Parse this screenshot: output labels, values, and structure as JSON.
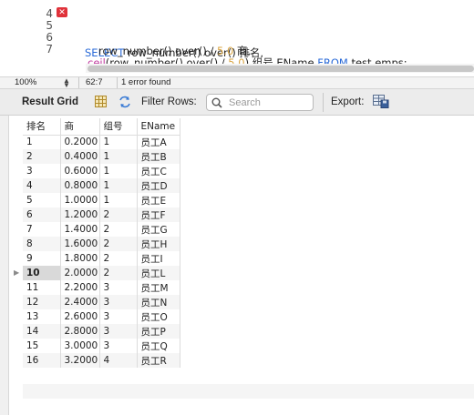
{
  "editor": {
    "lines": [
      {
        "number": "4",
        "has_error": false
      },
      {
        "number": "5",
        "has_error": true
      },
      {
        "number": "6",
        "has_error": false
      },
      {
        "number": "7",
        "has_error": false
      }
    ],
    "error_marker": "✕",
    "sql": {
      "line5_kw_select": "SELECT",
      "line5_rest": " row_number() over() 排名,",
      "line6_rest": "row_number() over() / ",
      "line6_num": "5.0",
      "line6_tail": " 商,",
      "line7_fn": "ceil",
      "line7_mid": "(row_number() over() / ",
      "line7_num": "5.0",
      "line7_tail": ") 组号,EName ",
      "line7_kw_from": "FROM",
      "line7_end": " test.emps;"
    }
  },
  "status": {
    "zoom": "100%",
    "cursor": "62:7",
    "message": "1 error found"
  },
  "toolbar": {
    "result_grid_label": "Result Grid",
    "filter_label": "Filter Rows:",
    "search_placeholder": "Search",
    "export_label": "Export:"
  },
  "grid": {
    "columns": [
      "排名",
      "商",
      "组号",
      "EName"
    ],
    "selected_row_index": 9,
    "rows": [
      [
        "1",
        "0.2000",
        "1",
        "员工A"
      ],
      [
        "2",
        "0.4000",
        "1",
        "员工B"
      ],
      [
        "3",
        "0.6000",
        "1",
        "员工C"
      ],
      [
        "4",
        "0.8000",
        "1",
        "员工D"
      ],
      [
        "5",
        "1.0000",
        "1",
        "员工E"
      ],
      [
        "6",
        "1.2000",
        "2",
        "员工F"
      ],
      [
        "7",
        "1.4000",
        "2",
        "员工G"
      ],
      [
        "8",
        "1.6000",
        "2",
        "员工H"
      ],
      [
        "9",
        "1.8000",
        "2",
        "员工I"
      ],
      [
        "10",
        "2.0000",
        "2",
        "员工L"
      ],
      [
        "11",
        "2.2000",
        "3",
        "员工M"
      ],
      [
        "12",
        "2.4000",
        "3",
        "员工N"
      ],
      [
        "13",
        "2.6000",
        "3",
        "员工O"
      ],
      [
        "14",
        "2.8000",
        "3",
        "员工P"
      ],
      [
        "15",
        "3.0000",
        "3",
        "员工Q"
      ],
      [
        "16",
        "3.2000",
        "4",
        "员工R"
      ]
    ]
  },
  "colors": {
    "keyword": "#2a6ad8",
    "function": "#c0399f",
    "number": "#d9a441",
    "error": "#e0323a"
  }
}
